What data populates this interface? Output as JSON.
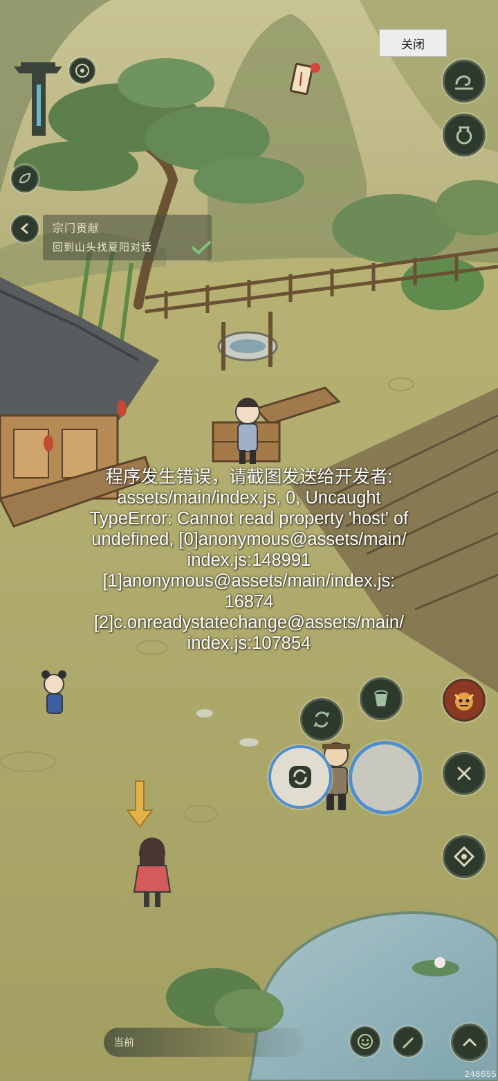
{
  "top_bar": {
    "close_label": "关闭"
  },
  "quest": {
    "title": "宗门贡献",
    "description": "回到山头找夏阳对话"
  },
  "error_message": "程序发生错误，请截图发送给开发者:\nassets/main/index.js, 0, Uncaught\nTypeError: Cannot read property 'host' of\nundefined, [0]anonymous@assets/main/\nindex.js:148991\n[1]anonymous@assets/main/index.js:\n16874\n[2]c.onreadystatechange@assets/main/\nindex.js:107854",
  "location": {
    "label": "当前"
  },
  "version_text": "248655",
  "icons": [
    "sect-gate-icon",
    "bagua-icon",
    "notice-scroll-icon",
    "cloud-map-icon",
    "jar-icon",
    "leaf-icon",
    "back-arrow-icon",
    "check-icon",
    "refresh-icon",
    "bucket-icon",
    "demon-portrait-icon",
    "cancel-x-icon",
    "cycle-action-icon",
    "compass-icon",
    "emote-icon",
    "brush-icon",
    "expand-up-icon",
    "quest-arrow-icon"
  ],
  "colors": {
    "grass": "#b6b070",
    "button_bg": "#2f3a2e",
    "button_ring": "#56624f",
    "accent_blue": "#4f8fd0",
    "error_text": "#ffffff"
  }
}
